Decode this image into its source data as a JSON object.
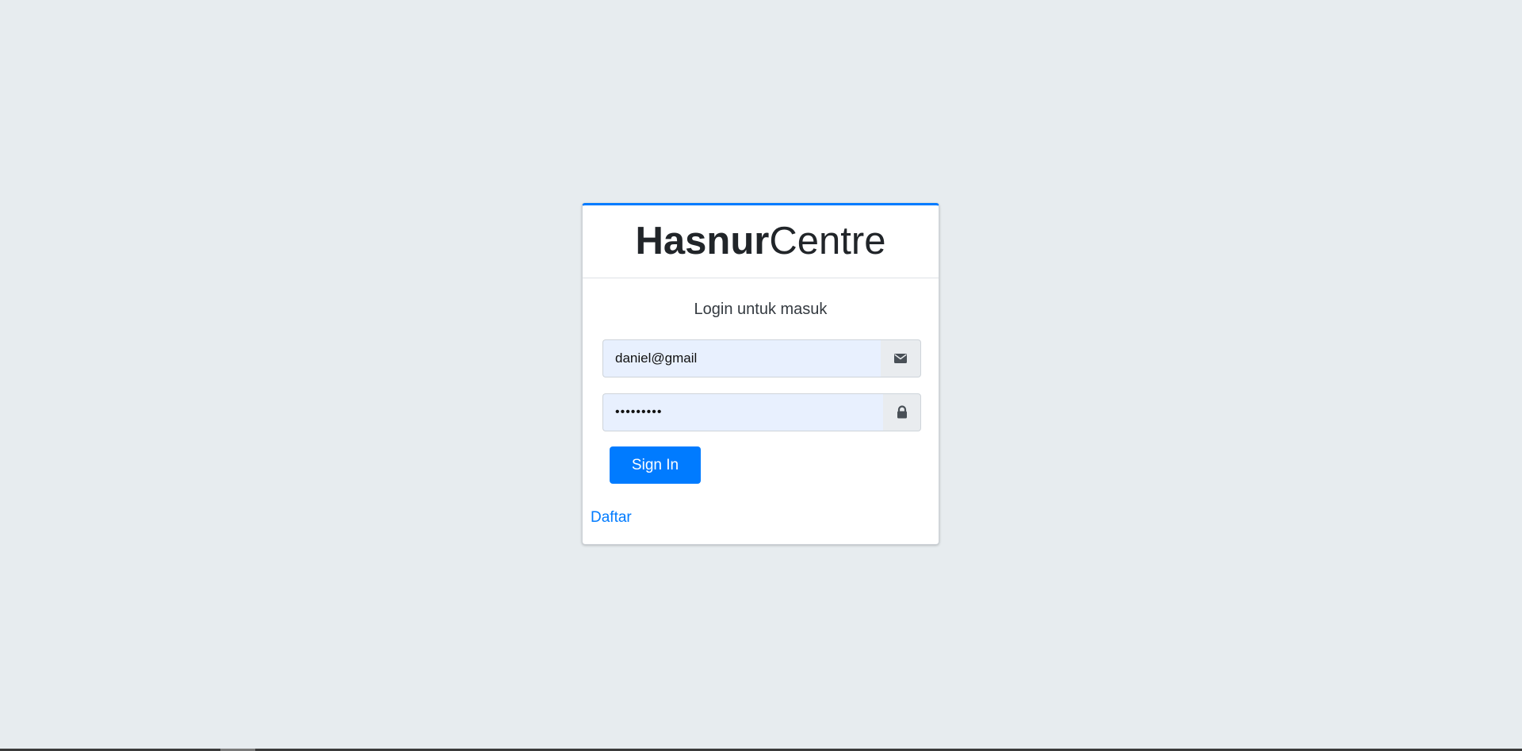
{
  "brand": {
    "bold": "Hasnur",
    "light": "Centre"
  },
  "login": {
    "message": "Login untuk masuk",
    "email": {
      "value": "daniel@gmail",
      "icon": "envelope-icon"
    },
    "password": {
      "value": "daniel123",
      "icon": "lock-icon"
    },
    "signin_label": "Sign In",
    "register_label": "Daftar"
  },
  "colors": {
    "background": "#e7ecef",
    "primary": "#007bff",
    "input_fill": "#e8f0fe"
  }
}
